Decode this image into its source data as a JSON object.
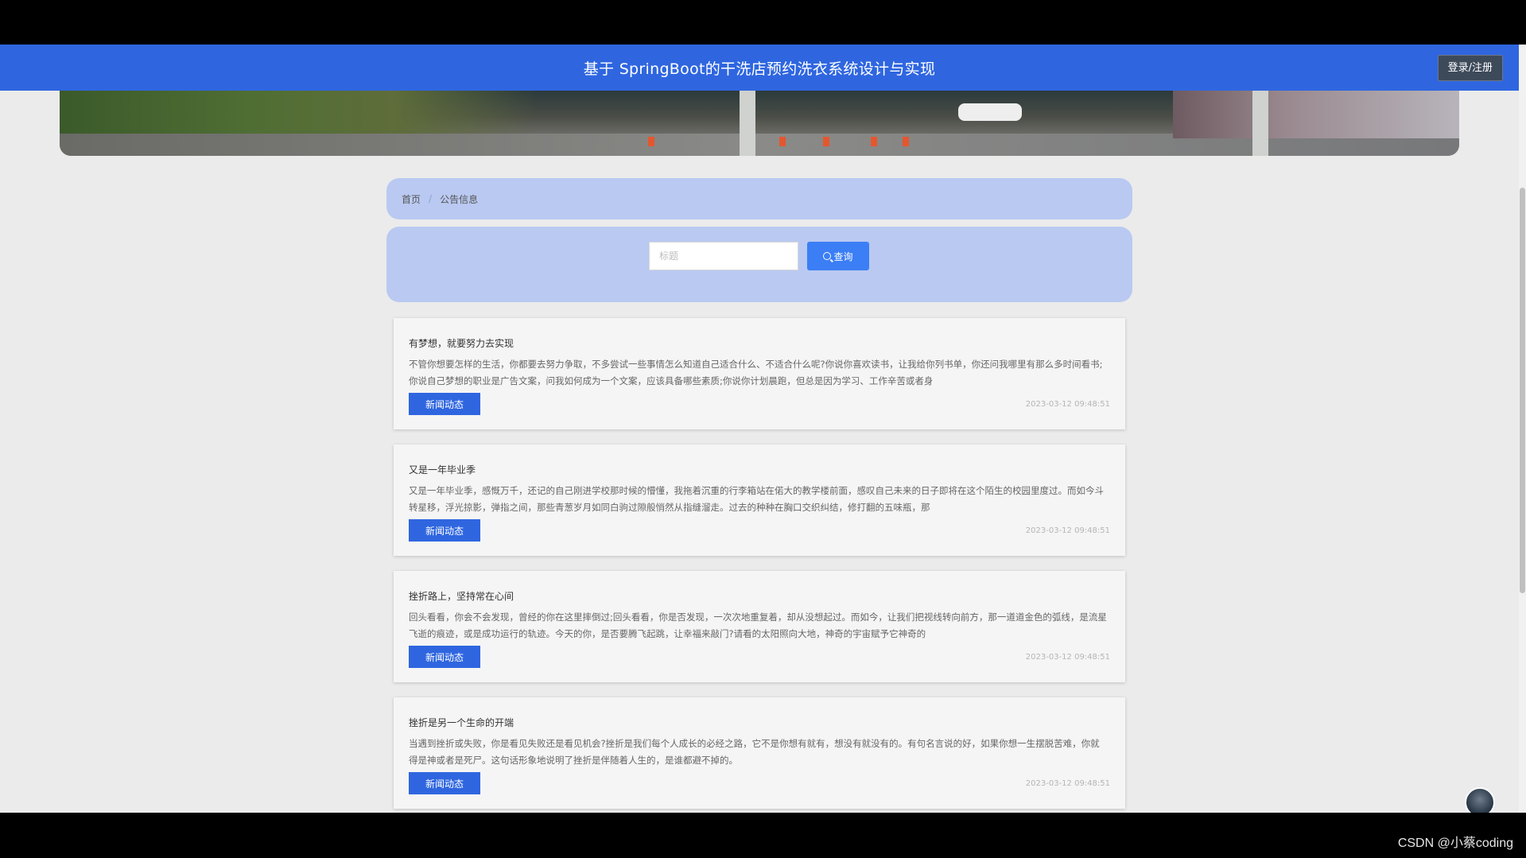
{
  "header": {
    "title": "基于 SpringBoot的干洗店预约洗衣系统设计与实现",
    "login_label": "登录/注册"
  },
  "breadcrumb": {
    "home": "首页",
    "current": "公告信息"
  },
  "search": {
    "placeholder": "标题",
    "button_label": "查询"
  },
  "announcements": [
    {
      "title": "有梦想，就要努力去实现",
      "body": "不管你想要怎样的生活，你都要去努力争取，不多尝试一些事情怎么知道自己适合什么、不适合什么呢?你说你喜欢读书，让我给你列书单，你还问我哪里有那么多时间看书;你说自己梦想的职业是广告文案，问我如何成为一个文案，应该具备哪些素质;你说你计划晨跑，但总是因为学习、工作辛苦或者身",
      "tag": "新闻动态",
      "date": "2023-03-12 09:48:51"
    },
    {
      "title": "又是一年毕业季",
      "body": "又是一年毕业季，感慨万千，还记的自己刚进学校那时候的懵懂，我拖着沉重的行李箱站在偌大的教学楼前面，感叹自己未来的日子即将在这个陌生的校园里度过。而如今斗转星移，浮光掠影，弹指之间，那些青葱岁月如同白驹过隙般悄然从指缝溜走。过去的种种在胸口交织纠结，修打翻的五味瓶，那",
      "tag": "新闻动态",
      "date": "2023-03-12 09:48:51"
    },
    {
      "title": "挫折路上，坚持常在心间",
      "body": "回头看看，你会不会发现，曾经的你在这里摔倒过;回头看看，你是否发现，一次次地重复着，却从没想起过。而如今，让我们把视线转向前方，那一道道金色的弧线，是流星飞逝的痕迹，或是成功运行的轨迹。今天的你，是否要腾飞起跳，让幸福来敲门?请看的太阳照向大地，神奇的宇宙赋予它神奇的",
      "tag": "新闻动态",
      "date": "2023-03-12 09:48:51"
    },
    {
      "title": "挫折是另一个生命的开端",
      "body": "当遇到挫折或失败，你是看见失败还是看见机会?挫折是我们每个人成长的必经之路，它不是你想有就有，想没有就没有的。有句名言说的好，如果你想一生摆脱苦难，你就得是神或者是死尸。这句话形象地说明了挫折是伴随着人生的，是谁都避不掉的。",
      "tag": "新闻动态",
      "date": "2023-03-12 09:48:51"
    }
  ],
  "watermark": "CSDN @小蔡coding"
}
